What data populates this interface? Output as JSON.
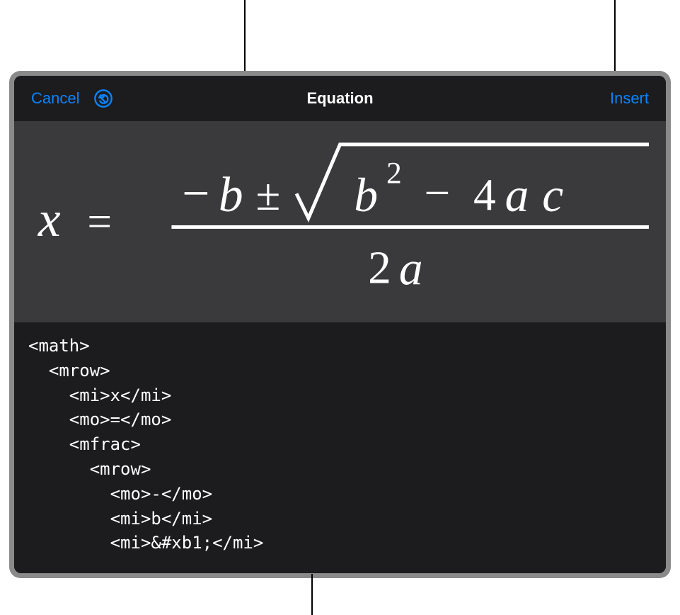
{
  "toolbar": {
    "cancel_label": "Cancel",
    "title": "Equation",
    "insert_label": "Insert"
  },
  "equation": {
    "display_tex": "x = \\frac{-b \\pm \\sqrt{b^2 - 4ac}}{2a}"
  },
  "code_lines": [
    "<math>",
    "  <mrow>",
    "    <mi>x</mi>",
    "    <mo>=</mo>",
    "    <mfrac>",
    "      <mrow>",
    "        <mo>-</mo>",
    "        <mi>b</mi>",
    "        <mi>&#xb1;</mi>"
  ],
  "colors": {
    "accent": "#0a84ff",
    "preview_bg": "#3a3a3c",
    "code_bg": "#1c1c1e",
    "frame_bg": "#8a8a8a",
    "text": "#ffffff"
  }
}
